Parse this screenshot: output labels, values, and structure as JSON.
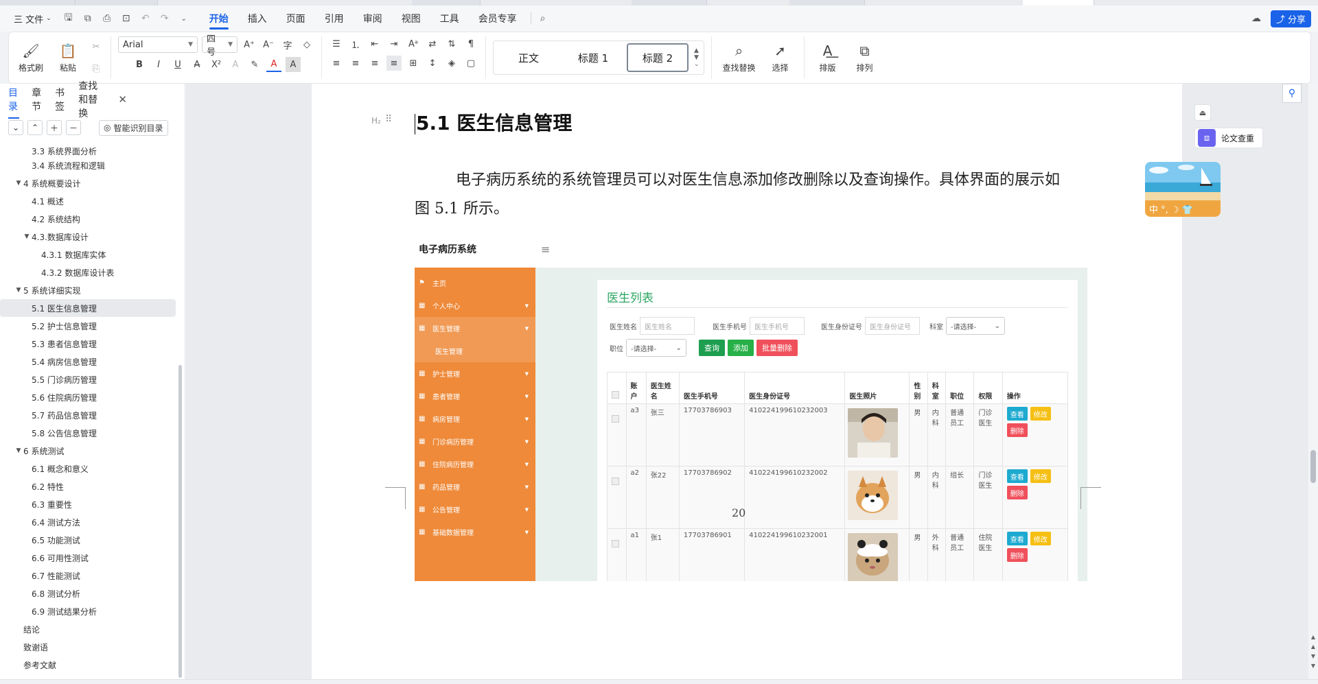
{
  "menubar": {
    "file_label": "三 文件",
    "tabs": [
      "开始",
      "插入",
      "页面",
      "引用",
      "审阅",
      "视图",
      "工具",
      "会员专享"
    ],
    "active_tab": "开始",
    "share_label": "分享"
  },
  "ribbon": {
    "format_painter": "格式刷",
    "paste": "粘贴",
    "font_name": "Arial",
    "font_size": "四号",
    "styles": [
      "正文",
      "标题 1",
      "标题 2"
    ],
    "find_replace": "查找替换",
    "select": "选择",
    "layout": "排版",
    "arrange": "排列"
  },
  "navpane": {
    "tabs": [
      "目录",
      "章节",
      "书签",
      "查找和替换"
    ],
    "smart_button": "智能识别目录",
    "toc": [
      {
        "label": "3.3 系统界面分析",
        "level": 2
      },
      {
        "label": "3.4 系统流程和逻辑",
        "level": 2
      },
      {
        "label": "4 系统概要设计",
        "level": 1,
        "expanded": true
      },
      {
        "label": "4.1 概述",
        "level": 2
      },
      {
        "label": "4.2 系统结构",
        "level": 2
      },
      {
        "label": "4.3.数据库设计",
        "level": 2,
        "expanded": true
      },
      {
        "label": "4.3.1 数据库实体",
        "level": 3
      },
      {
        "label": "4.3.2 数据库设计表",
        "level": 3
      },
      {
        "label": "5 系统详细实现",
        "level": 1,
        "expanded": true
      },
      {
        "label": "5.1  医生信息管理",
        "level": 2,
        "selected": true
      },
      {
        "label": "5.2  护士信息管理",
        "level": 2
      },
      {
        "label": "5.3  患者信息管理",
        "level": 2
      },
      {
        "label": "5.4  病房信息管理",
        "level": 2
      },
      {
        "label": "5.5  门诊病历管理",
        "level": 2
      },
      {
        "label": "5.6  住院病历管理",
        "level": 2
      },
      {
        "label": "5.7  药品信息管理",
        "level": 2
      },
      {
        "label": "5.8  公告信息管理",
        "level": 2
      },
      {
        "label": "6 系统测试",
        "level": 1,
        "expanded": true
      },
      {
        "label": "6.1 概念和意义",
        "level": 2
      },
      {
        "label": "6.2 特性",
        "level": 2
      },
      {
        "label": "6.3 重要性",
        "level": 2
      },
      {
        "label": "6.4 测试方法",
        "level": 2
      },
      {
        "label": "6.5  功能测试",
        "level": 2
      },
      {
        "label": "6.6 可用性测试",
        "level": 2
      },
      {
        "label": "6.7 性能测试",
        "level": 2
      },
      {
        "label": "6.8 测试分析",
        "level": 2
      },
      {
        "label": "6.9 测试结果分析",
        "level": 2
      },
      {
        "label": "结论",
        "level": 1
      },
      {
        "label": "致谢语",
        "level": 1
      },
      {
        "label": "参考文献",
        "level": 1
      }
    ]
  },
  "document": {
    "heading": "5.1  医生信息管理",
    "paragraph": "电子病历系统的系统管理员可以对医生信息添加修改删除以及查询操作。具体界面的展示如图 5.1 所示。",
    "page_number": "20"
  },
  "screenshot": {
    "app_title": "电子病历系统",
    "menu": [
      {
        "label": "主页",
        "icon": "flag-icon"
      },
      {
        "label": "个人中心",
        "icon": "grid-icon",
        "has_sub": true
      },
      {
        "label": "医生管理",
        "icon": "grid-icon",
        "has_sub": true,
        "open": true
      },
      {
        "label": "医生管理",
        "sub": true
      },
      {
        "label": "护士管理",
        "icon": "grid-icon",
        "has_sub": true
      },
      {
        "label": "患者管理",
        "icon": "grid-icon",
        "has_sub": true
      },
      {
        "label": "病房管理",
        "icon": "grid-icon",
        "has_sub": true
      },
      {
        "label": "门诊病历管理",
        "icon": "grid-icon",
        "has_sub": true
      },
      {
        "label": "住院病历管理",
        "icon": "grid-icon",
        "has_sub": true
      },
      {
        "label": "药品管理",
        "icon": "grid-icon",
        "has_sub": true
      },
      {
        "label": "公告管理",
        "icon": "grid-icon",
        "has_sub": true
      },
      {
        "label": "基础数据管理",
        "icon": "grid-icon",
        "has_sub": true
      }
    ],
    "panel_title": "医生列表",
    "filters": {
      "name_label": "医生姓名",
      "name_placeholder": "医生姓名",
      "phone_label": "医生手机号",
      "phone_placeholder": "医生手机号",
      "id_label": "医生身份证号",
      "id_placeholder": "医生身份证号",
      "dept_label": "科室",
      "dept_value": "-请选择-",
      "post_label": "职位",
      "post_value": "-请选择-"
    },
    "buttons": {
      "query": "查询",
      "add": "添加",
      "batch_delete": "批量删除"
    },
    "columns": [
      "账户",
      "医生姓名",
      "医生手机号",
      "医生身份证号",
      "医生照片",
      "性别",
      "科室",
      "职位",
      "权限",
      "操作"
    ],
    "rows": [
      {
        "account": "a3",
        "name": "张三",
        "phone": "17703786903",
        "idno": "410224199610232003",
        "gender": "男",
        "dept": "内科",
        "post": "普通员工",
        "perm": "门诊医生",
        "photo": "person"
      },
      {
        "account": "a2",
        "name": "张22",
        "phone": "17703786902",
        "idno": "410224199610232002",
        "gender": "男",
        "dept": "内科",
        "post": "组长",
        "perm": "门诊医生",
        "photo": "dog"
      },
      {
        "account": "a1",
        "name": "张1",
        "phone": "17703786901",
        "idno": "410224199610232001",
        "gender": "男",
        "dept": "外科",
        "post": "普通员工",
        "perm": "住院医生",
        "photo": "cat"
      }
    ],
    "row_actions": {
      "view": "查看",
      "edit": "修改",
      "delete": "删除"
    },
    "colors": {
      "sidebar": "#ee8a3a",
      "title": "#2aa560",
      "query": "#1e9e4f",
      "add": "#27b048",
      "delete": "#f0505b",
      "view": "#1eaad0",
      "edit": "#f5bf14"
    }
  },
  "side_widgets": {
    "thesis_check": "论文查重",
    "ime_bar": "中 °, ☽ 👕"
  }
}
